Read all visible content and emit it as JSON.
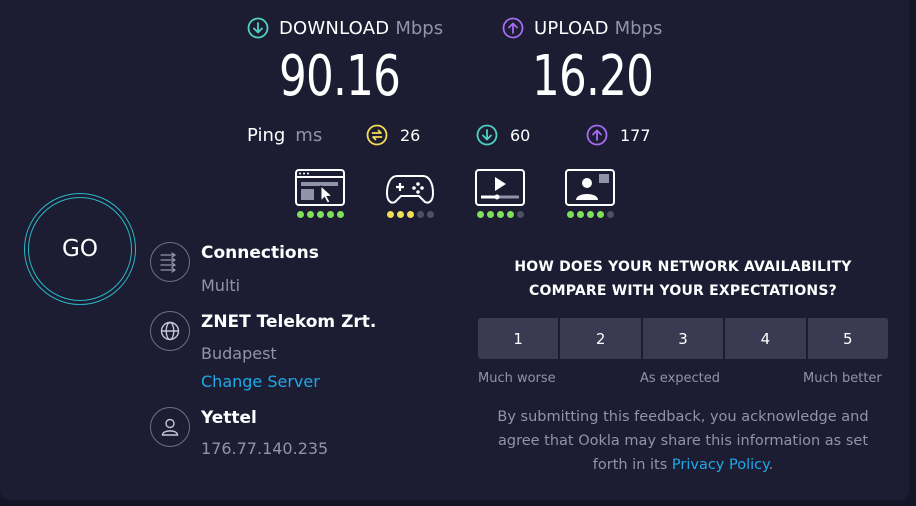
{
  "header": {
    "download": {
      "label": "DOWNLOAD",
      "unit": "Mbps",
      "value": "90.16",
      "icon": "download-circle-icon",
      "color": "#4fd1c5"
    },
    "upload": {
      "label": "UPLOAD",
      "unit": "Mbps",
      "value": "16.20",
      "icon": "upload-circle-icon",
      "color": "#a66bf0"
    }
  },
  "ping": {
    "label": "Ping",
    "unit": "ms",
    "idle": {
      "value": "26",
      "icon": "idle-ping-icon",
      "color": "#f4dc55"
    },
    "download": {
      "value": "60",
      "icon": "download-ping-icon",
      "color": "#4fd1c5"
    },
    "upload": {
      "value": "177",
      "icon": "upload-ping-icon",
      "color": "#a66bf0"
    }
  },
  "apps": [
    {
      "name": "web-browsing-icon",
      "rating": 5,
      "max": 5,
      "color": "#7ee05a"
    },
    {
      "name": "gaming-icon",
      "rating": 3,
      "max": 5,
      "color": "#f4dc55"
    },
    {
      "name": "video-streaming-icon",
      "rating": 4,
      "max": 5,
      "color": "#7ee05a"
    },
    {
      "name": "video-chat-icon",
      "rating": 4,
      "max": 5,
      "color": "#7ee05a"
    }
  ],
  "go_button": {
    "label": "GO",
    "accent": "#2ab6c4"
  },
  "connections": {
    "title": "Connections",
    "value": "Multi",
    "icon": "connections-icon"
  },
  "server": {
    "title": "ZNET Telekom Zrt.",
    "location": "Budapest",
    "change_link": "Change Server",
    "icon": "globe-icon"
  },
  "provider": {
    "title": "Yettel",
    "ip": "176.77.140.235",
    "icon": "user-icon"
  },
  "survey": {
    "question_line1": "HOW DOES YOUR NETWORK AVAILABILITY",
    "question_line2": "COMPARE WITH YOUR EXPECTATIONS?",
    "options": [
      "1",
      "2",
      "3",
      "4",
      "5"
    ],
    "low_label": "Much worse",
    "mid_label": "As expected",
    "high_label": "Much better",
    "disclaimer_line1": "By submitting this feedback, you acknowledge and",
    "disclaimer_line2": "agree that Ookla may share this information as set",
    "disclaimer_line3_prefix": "forth in its",
    "privacy_link": "Privacy Policy",
    "disclaimer_suffix": ".",
    "link_color": "#1fa8e8"
  }
}
